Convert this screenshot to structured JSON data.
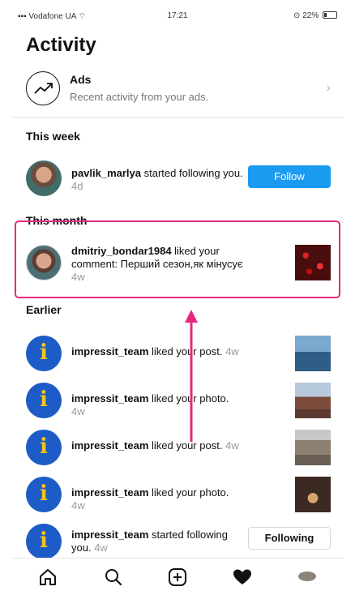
{
  "status_bar": {
    "carrier": "Vodafone UA",
    "time": "17:21",
    "battery": "22%"
  },
  "page_title": "Activity",
  "ads": {
    "title": "Ads",
    "subtitle": "Recent activity from your ads.",
    "icon": "trending-up-icon"
  },
  "sections": {
    "this_week": "This week",
    "this_month": "This month",
    "earlier": "Earlier"
  },
  "week": {
    "username": "pavlik_marlya",
    "action": " started following you.",
    "time": "4d",
    "button": "Follow"
  },
  "month": {
    "username": "dmitriy_bondar1984",
    "action": " liked your comment: Перший сезон,як мінусує",
    "time": "4w"
  },
  "earlier": [
    {
      "username": "impressit_team",
      "action": " liked your post.",
      "time": "4w"
    },
    {
      "username": "impressit_team",
      "action": " liked your photo.",
      "time": "4w"
    },
    {
      "username": "impressit_team",
      "action": " liked your post.",
      "time": "4w"
    },
    {
      "username": "impressit_team",
      "action": " liked your photo.",
      "time": "4w"
    },
    {
      "username": "impressit_team",
      "action": " started following you.",
      "time": "4w",
      "button": "Following"
    }
  ],
  "tabs": [
    "home-icon",
    "search-icon",
    "add-post-icon",
    "heart-icon",
    "profile-icon"
  ],
  "colors": {
    "accent_blue": "#1a9bf0",
    "highlight_pink": "#e6287f",
    "brand_blue": "#1d5bc6",
    "brand_yellow": "#f6c419"
  }
}
